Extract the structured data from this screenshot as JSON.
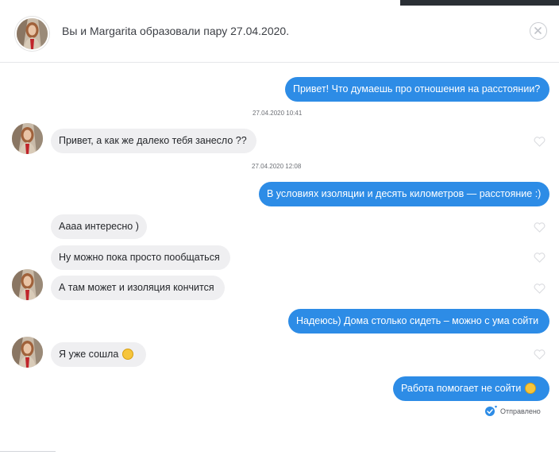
{
  "header": {
    "title": "Вы и Margarita образовали пару 27.04.2020.",
    "close_icon": "close-icon"
  },
  "messages": [
    {
      "side": "out",
      "text": "Привет! Что думаешь про отношения на расстоянии?"
    },
    {
      "side": "in",
      "text": "Привет, а как же далеко тебя занесло ??"
    },
    {
      "side": "out",
      "text": "В условиях изоляции и десять километров — расстояние :)"
    },
    {
      "side": "in",
      "text": "Аааа интересно )"
    },
    {
      "side": "in",
      "text": "Ну можно пока просто пообщаться"
    },
    {
      "side": "in",
      "text": "А там может и изоляция кончится"
    },
    {
      "side": "out",
      "text": "Надеюсь) Дома столько сидеть – можно с ума сойти"
    },
    {
      "side": "in",
      "text": "Я уже сошла",
      "emoji": "crazy-face-emoji"
    },
    {
      "side": "out",
      "text": "Работа помогает не сойти",
      "emoji": "smile-emoji"
    }
  ],
  "timestamps": [
    "27.04.2020 10:41",
    "27.04.2020 12:08"
  ],
  "status": {
    "text": "Отправлено",
    "icon": "sent-check-icon"
  },
  "colors": {
    "outgoing_bubble": "#2d8ce6",
    "incoming_bubble": "#efeff1",
    "text_dark": "#25272b"
  }
}
